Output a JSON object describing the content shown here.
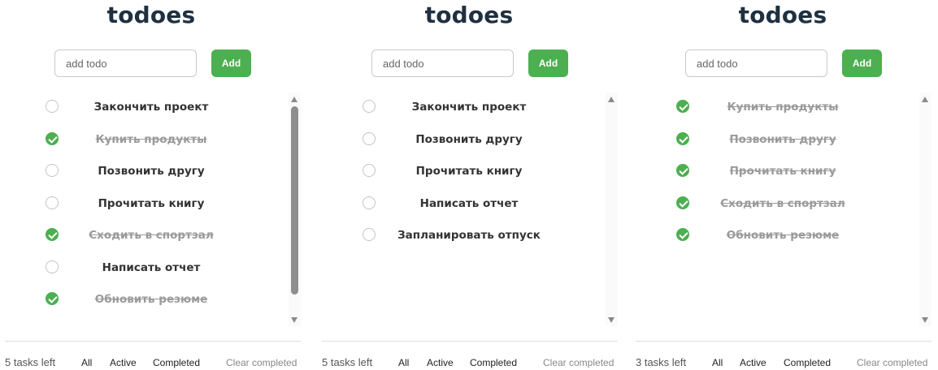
{
  "colors": {
    "accent": "#4caf50",
    "title": "#1f3040",
    "done_text": "#9a9a9a"
  },
  "panels": [
    {
      "title": "todoes",
      "input": {
        "placeholder": "add todo",
        "value": ""
      },
      "add_label": "Add",
      "items": [
        {
          "text": "Закончить проект",
          "done": false
        },
        {
          "text": "Купить продукты",
          "done": true
        },
        {
          "text": "Позвонить другу",
          "done": false
        },
        {
          "text": "Прочитать книгу",
          "done": false
        },
        {
          "text": "Сходить в спортзал",
          "done": true
        },
        {
          "text": "Написать отчет",
          "done": false
        },
        {
          "text": "Обновить резюме",
          "done": true
        }
      ],
      "footer": {
        "count": "5 tasks left",
        "all": "All",
        "active": "Active",
        "completed": "Completed",
        "clear": "Clear completed"
      }
    },
    {
      "title": "todoes",
      "input": {
        "placeholder": "add todo",
        "value": ""
      },
      "add_label": "Add",
      "items": [
        {
          "text": "Закончить проект",
          "done": false
        },
        {
          "text": "Позвонить другу",
          "done": false
        },
        {
          "text": "Прочитать книгу",
          "done": false
        },
        {
          "text": "Написать отчет",
          "done": false
        },
        {
          "text": "Запланировать отпуск",
          "done": false
        }
      ],
      "footer": {
        "count": "5 tasks left",
        "all": "All",
        "active": "Active",
        "completed": "Completed",
        "clear": "Clear completed"
      }
    },
    {
      "title": "todoes",
      "input": {
        "placeholder": "add todo",
        "value": ""
      },
      "add_label": "Add",
      "items": [
        {
          "text": "Купить продукты",
          "done": true
        },
        {
          "text": "Позвонить другу",
          "done": true
        },
        {
          "text": "Прочитать книгу",
          "done": true
        },
        {
          "text": "Сходить в спортзал",
          "done": true
        },
        {
          "text": "Обновить резюме",
          "done": true
        }
      ],
      "footer": {
        "count": "3 tasks left",
        "all": "All",
        "active": "Active",
        "completed": "Completed",
        "clear": "Clear completed"
      }
    }
  ]
}
